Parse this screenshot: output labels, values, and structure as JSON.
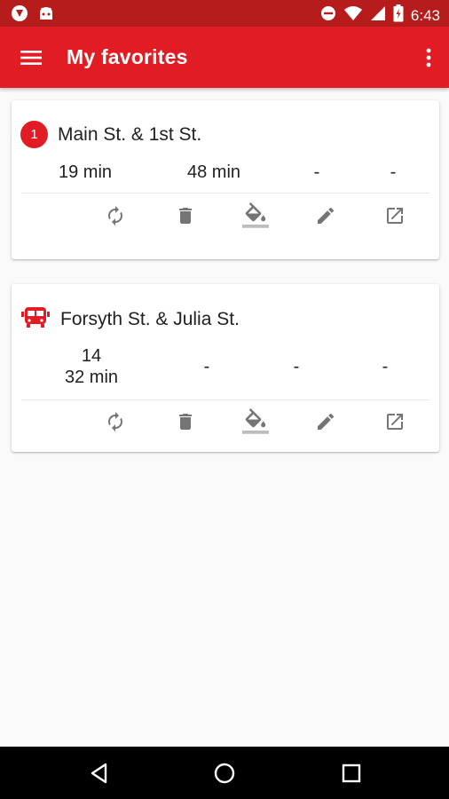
{
  "status_bar": {
    "time": "6:43",
    "left_icons": [
      "shield-app-icon",
      "android-icon"
    ],
    "right_icons": [
      "do-not-disturb-icon",
      "wifi-icon",
      "signal-icon",
      "battery-icon"
    ]
  },
  "app_bar": {
    "title": "My favorites",
    "menu_icon": "hamburger-menu-icon",
    "overflow_icon": "more-vert-icon"
  },
  "colors": {
    "primary": "#e21c24",
    "status_bar": "#b71c1c",
    "icon_grey": "#757575",
    "background": "#fafafa"
  },
  "favorites": [
    {
      "badge": "1",
      "badge_type": "route-number",
      "name": "Main St. & 1st St.",
      "times": [
        "19 min",
        "48 min",
        "-",
        "-"
      ]
    },
    {
      "badge_type": "bus-icon",
      "name": "Forsyth St. & Julia St.",
      "times": [
        "14\n32 min",
        "-",
        "-",
        "-"
      ],
      "times_first_lines": [
        "14",
        "32 min"
      ]
    }
  ],
  "actions": [
    "refresh-icon",
    "delete-icon",
    "color-fill-icon",
    "edit-icon",
    "open-in-new-icon"
  ],
  "nav_bar": [
    "back-icon",
    "home-icon",
    "recents-icon"
  ]
}
